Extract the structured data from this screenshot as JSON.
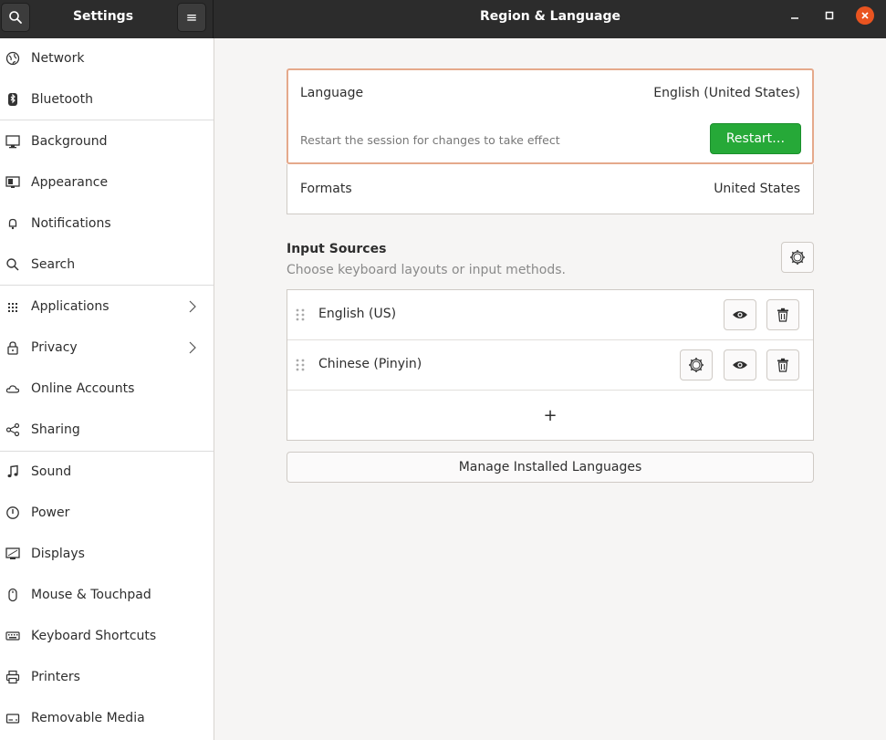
{
  "header": {
    "left_title": "Settings",
    "title": "Region & Language",
    "menu_glyph": "≡"
  },
  "sidebar": {
    "items": [
      {
        "label": "Network",
        "icon": "network-icon"
      },
      {
        "label": "Bluetooth",
        "icon": "bluetooth-icon"
      },
      {
        "label": "Background",
        "icon": "background-icon"
      },
      {
        "label": "Appearance",
        "icon": "appearance-icon"
      },
      {
        "label": "Notifications",
        "icon": "bell-icon"
      },
      {
        "label": "Search",
        "icon": "search-icon"
      },
      {
        "label": "Applications",
        "icon": "grid-icon"
      },
      {
        "label": "Privacy",
        "icon": "lock-icon"
      },
      {
        "label": "Online Accounts",
        "icon": "cloud-icon"
      },
      {
        "label": "Sharing",
        "icon": "share-icon"
      },
      {
        "label": "Sound",
        "icon": "music-note-icon"
      },
      {
        "label": "Power",
        "icon": "power-icon"
      },
      {
        "label": "Displays",
        "icon": "display-icon"
      },
      {
        "label": "Mouse & Touchpad",
        "icon": "mouse-icon"
      },
      {
        "label": "Keyboard Shortcuts",
        "icon": "keyboard-icon"
      },
      {
        "label": "Printers",
        "icon": "printer-icon"
      },
      {
        "label": "Removable Media",
        "icon": "removable-media-icon"
      }
    ]
  },
  "language": {
    "label": "Language",
    "value": "English (United States)",
    "restart_text": "Restart the session for changes to take effect",
    "restart_button": "Restart…"
  },
  "formats": {
    "label": "Formats",
    "value": "United States"
  },
  "input_sources": {
    "title": "Input Sources",
    "subtitle": "Choose keyboard layouts or input methods.",
    "sources": [
      {
        "label": "English (US)",
        "has_settings": false
      },
      {
        "label": "Chinese (Pinyin)",
        "has_settings": true
      }
    ],
    "add_glyph": "+"
  },
  "manage_button": "Manage Installed Languages",
  "colors": {
    "header_bg": "#2c2c2c",
    "accent_close": "#e95420",
    "restart_green": "#26a938",
    "highlight_border": "#e5a98b"
  }
}
